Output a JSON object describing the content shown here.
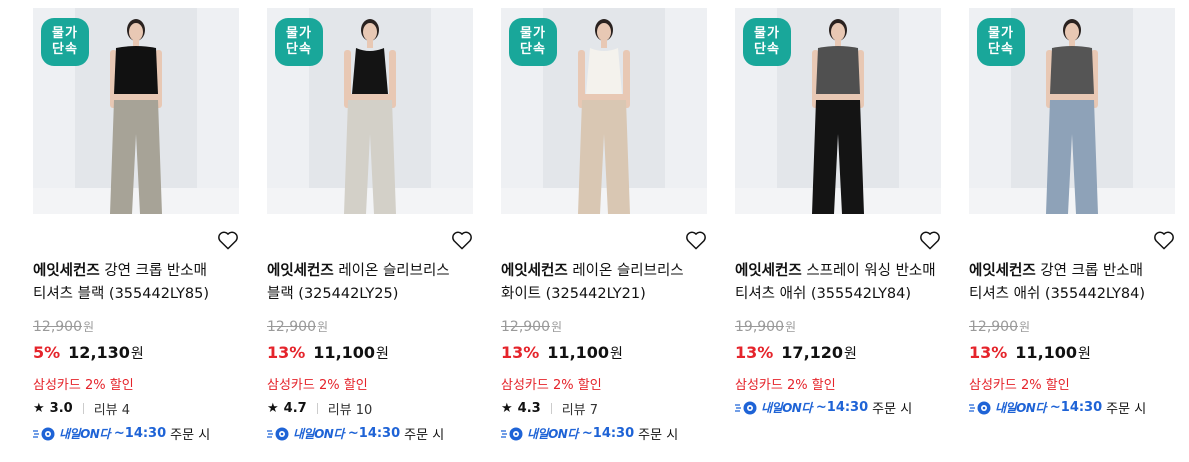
{
  "colors": {
    "accent_red": "#e5242b",
    "badge_teal": "#19a79a",
    "delivery_blue": "#1e63d6"
  },
  "products": [
    {
      "badge": [
        "물가",
        "단속"
      ],
      "brand": "에잇세컨즈",
      "name": "강연 크롭 반소매 티셔츠 블랙 (355442LY85)",
      "original_price": "12,900",
      "original_unit": "원",
      "discount_rate": "5%",
      "sale_price": "12,130",
      "price_unit": "원",
      "card_discount": "삼성카드 2% 할인",
      "rating": "3.0",
      "review": "리뷰 4",
      "delivery_label": "내일ON다",
      "delivery_time": "~14:30",
      "delivery_suffix": "주문 시",
      "top_color": "#111111",
      "bottom_color": "#a7a397",
      "icon": "heart-outline-icon"
    },
    {
      "badge": [
        "물가",
        "단속"
      ],
      "brand": "에잇세컨즈",
      "name": "레이온 슬리브리스 블랙 (325442LY25)",
      "original_price": "12,900",
      "original_unit": "원",
      "discount_rate": "13%",
      "sale_price": "11,100",
      "price_unit": "원",
      "card_discount": "삼성카드 2% 할인",
      "rating": "4.7",
      "review": "리뷰 10",
      "delivery_label": "내일ON다",
      "delivery_time": "~14:30",
      "delivery_suffix": "주문 시",
      "top_color": "#141414",
      "bottom_color": "#d3d0c8",
      "icon": "heart-outline-icon"
    },
    {
      "badge": [
        "물가",
        "단속"
      ],
      "brand": "에잇세컨즈",
      "name": "레이온 슬리브리스 화이트 (325442LY21)",
      "original_price": "12,900",
      "original_unit": "원",
      "discount_rate": "13%",
      "sale_price": "11,100",
      "price_unit": "원",
      "card_discount": "삼성카드 2% 할인",
      "rating": "4.3",
      "review": "리뷰 7",
      "delivery_label": "내일ON다",
      "delivery_time": "~14:30",
      "delivery_suffix": "주문 시",
      "top_color": "#f4f2ed",
      "bottom_color": "#d9c7b3",
      "icon": "heart-outline-icon"
    },
    {
      "badge": [
        "물가",
        "단속"
      ],
      "brand": "에잇세컨즈",
      "name": "스프레이 워싱 반소매 티셔츠 애쉬 (355542LY84)",
      "original_price": "19,900",
      "original_unit": "원",
      "discount_rate": "13%",
      "sale_price": "17,120",
      "price_unit": "원",
      "card_discount": "삼성카드 2% 할인",
      "rating": "",
      "review": "",
      "delivery_label": "내일ON다",
      "delivery_time": "~14:30",
      "delivery_suffix": "주문 시",
      "top_color": "#505050",
      "bottom_color": "#141414",
      "icon": "heart-outline-icon"
    },
    {
      "badge": [
        "물가",
        "단속"
      ],
      "brand": "에잇세컨즈",
      "name": "강연 크롭 반소매 티셔츠 애쉬 (355442LY84)",
      "original_price": "12,900",
      "original_unit": "원",
      "discount_rate": "13%",
      "sale_price": "11,100",
      "price_unit": "원",
      "card_discount": "삼성카드 2% 할인",
      "rating": "",
      "review": "",
      "delivery_label": "내일ON다",
      "delivery_time": "~14:30",
      "delivery_suffix": "주문 시",
      "top_color": "#555555",
      "bottom_color": "#8ea2b8",
      "icon": "heart-outline-icon"
    }
  ]
}
